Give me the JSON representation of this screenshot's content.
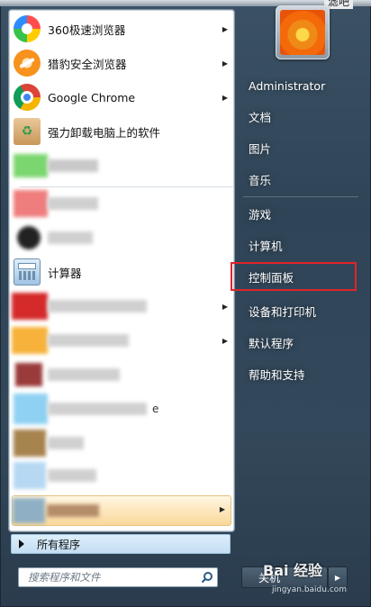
{
  "top_strip": {
    "text": "滤吧"
  },
  "pinned": [
    {
      "label": "360极速浏览器",
      "icon": "browser-360-icon",
      "has_submenu": true
    },
    {
      "label": "猎豹安全浏览器",
      "icon": "cheetah-browser-icon",
      "has_submenu": true
    },
    {
      "label": "Google Chrome",
      "icon": "chrome-icon",
      "has_submenu": true
    },
    {
      "label": "强力卸载电脑上的软件",
      "icon": "uninstall-box-icon",
      "has_submenu": false
    }
  ],
  "recent": [
    {
      "label": "计算器",
      "icon": "calculator-icon"
    },
    {
      "label": "e",
      "icon": "blurred-app-icon"
    }
  ],
  "all_programs": {
    "label": "所有程序"
  },
  "search": {
    "placeholder": "搜索程序和文件"
  },
  "right_links": [
    "Administrator",
    "文档",
    "图片",
    "音乐",
    "游戏",
    "计算机",
    "控制面板",
    "设备和打印机",
    "默认程序",
    "帮助和支持"
  ],
  "shutdown": {
    "label": "关机"
  },
  "watermark": {
    "main": "Bai 经验",
    "sub": "jingyan.baidu.com"
  },
  "colors": {
    "highlight_box": "#e0242a",
    "accent": "#2f4557"
  }
}
